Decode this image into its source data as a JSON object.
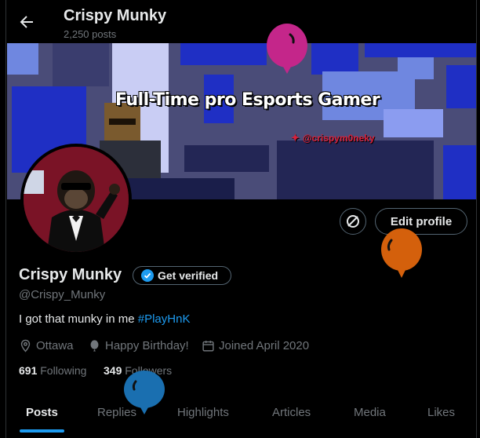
{
  "header": {
    "name": "Crispy Munky",
    "post_count": "2,250 posts"
  },
  "banner": {
    "title": "Full-Time pro Esports Gamer",
    "handle": "@crispym0neky"
  },
  "profile": {
    "display_name": "Crispy Munky",
    "verified_label": "Get verified",
    "handle": "@Crispy_Munky",
    "bio_text": "I got that munky in me ",
    "bio_hashtag": "#PlayHnK",
    "location": "Ottawa",
    "birthday": "Happy Birthday!",
    "joined": "Joined April 2020",
    "following_count": "691",
    "following_label": "Following",
    "followers_count": "349",
    "followers_label": "Followers"
  },
  "actions": {
    "edit_profile": "Edit profile"
  },
  "tabs": [
    {
      "label": "Posts"
    },
    {
      "label": "Replies"
    },
    {
      "label": "Highlights"
    },
    {
      "label": "Articles"
    },
    {
      "label": "Media"
    },
    {
      "label": "Likes"
    }
  ],
  "colors": {
    "accent": "#1d9bf0",
    "background": "#000000",
    "text": "#e7e9ea",
    "muted": "#71767b"
  },
  "icons": [
    "back-arrow-icon",
    "verified-badge-icon",
    "location-icon",
    "balloon-icon",
    "calendar-icon",
    "sync-icon",
    "twitter-bird-icon"
  ]
}
